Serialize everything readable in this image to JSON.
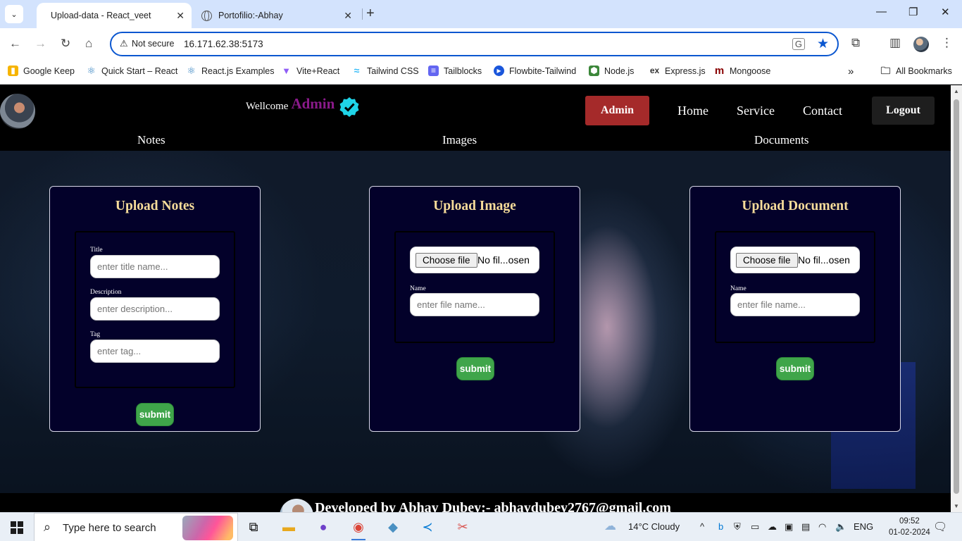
{
  "browser": {
    "tabs": [
      {
        "title": "Upload-data - React_veet",
        "active": true
      },
      {
        "title": "Portofilio:-Abhay",
        "active": false
      }
    ],
    "security_label": "Not secure",
    "url": "16.171.62.38:5173",
    "bookmarks": [
      {
        "label": "Google Keep",
        "icon": "google-keep-icon",
        "color": "#f6b400"
      },
      {
        "label": "Quick Start – React",
        "icon": "react-icon",
        "color": "#2f7fbf"
      },
      {
        "label": "React.js Examples",
        "icon": "react-icon",
        "color": "#2f7fbf"
      },
      {
        "label": "Vite+React",
        "icon": "vite-icon",
        "color": "#8f5cf6"
      },
      {
        "label": "Tailwind CSS",
        "icon": "tailwind-icon",
        "color": "#38bdf8"
      },
      {
        "label": "Tailblocks",
        "icon": "tailblocks-icon",
        "color": "#6366f1"
      },
      {
        "label": "Flowbite-Tailwind",
        "icon": "flowbite-icon",
        "color": "#1a56db"
      },
      {
        "label": "Node.js",
        "icon": "nodejs-icon",
        "color": "#3c873a"
      },
      {
        "label": "Express.js",
        "icon": "express-icon",
        "color": "#333333"
      },
      {
        "label": "Mongoose",
        "icon": "mongoose-icon",
        "color": "#880000"
      }
    ],
    "all_bookmarks": "All Bookmarks"
  },
  "header": {
    "welcome": "Wellcome",
    "role_name": "Admin",
    "admin_button": "Admin",
    "nav": [
      "Home",
      "Service",
      "Contact"
    ],
    "logout_button": "Logout",
    "subnav": [
      "Notes",
      "Images",
      "Documents"
    ],
    "verified_color": "#1fd4e8"
  },
  "cards": {
    "notes": {
      "title": "Upload Notes",
      "fields": [
        {
          "label": "Title",
          "placeholder": "enter title name..."
        },
        {
          "label": "Description",
          "placeholder": "enter description..."
        },
        {
          "label": "Tag",
          "placeholder": "enter tag..."
        }
      ],
      "submit": "submit"
    },
    "image": {
      "title": "Upload Image",
      "file_button": "Choose file",
      "file_status": "No fil...osen",
      "name_label": "Name",
      "name_placeholder": "enter file name...",
      "submit": "submit"
    },
    "document": {
      "title": "Upload Document",
      "file_button": "Choose file",
      "file_status": "No fil...osen",
      "name_label": "Name",
      "name_placeholder": "enter file name...",
      "submit": "submit"
    }
  },
  "footer": {
    "credit": "Developed by Abhay Dubey:- abhaydubey2767@gmail.com"
  },
  "taskbar": {
    "search_placeholder": "Type here to search",
    "weather": "14°C  Cloudy",
    "language": "ENG",
    "time": "09:52",
    "date": "01-02-2024"
  },
  "colors": {
    "accent": "#0b57d0",
    "admin_button": "#a52a2a",
    "card_title": "#f6dc9a",
    "submit": "#3fa54a",
    "card_bg": "#03012a"
  }
}
